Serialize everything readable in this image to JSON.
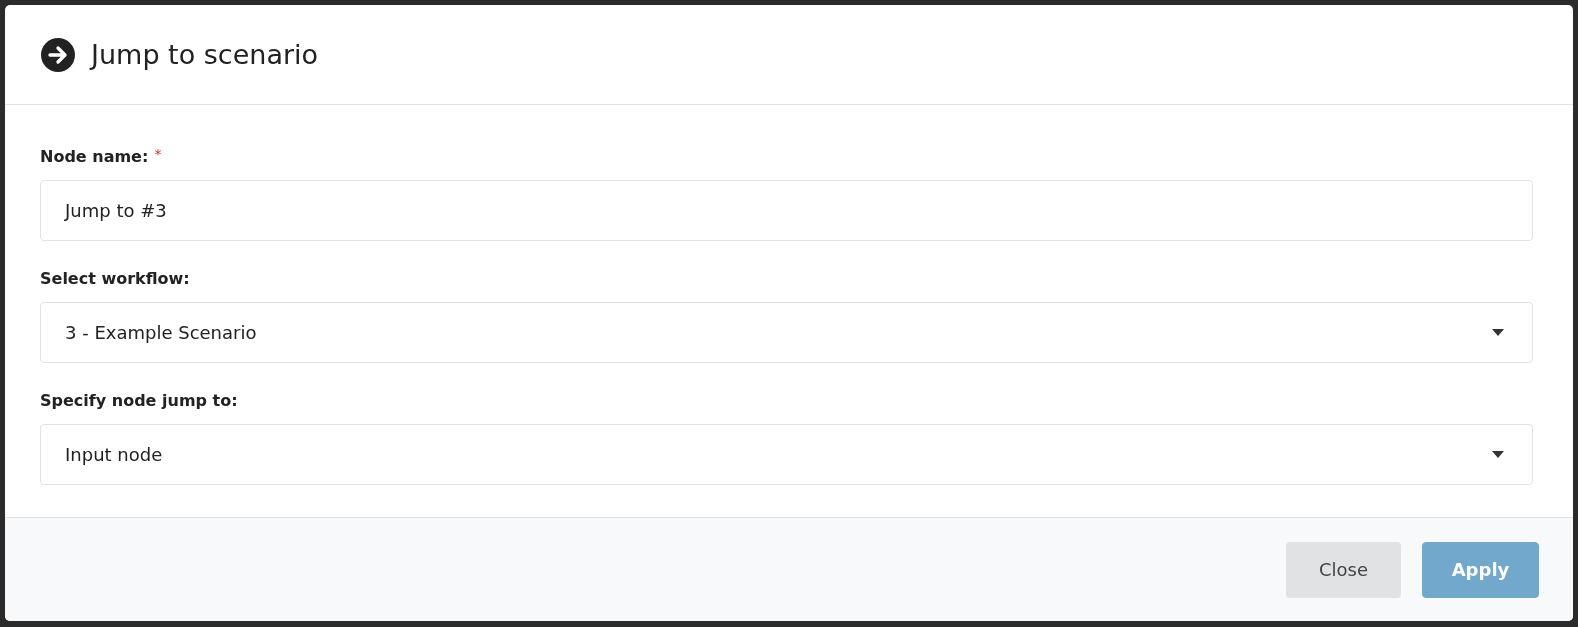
{
  "dialog": {
    "title": "Jump to scenario",
    "fields": [
      {
        "kind": "text",
        "label": "Node name:",
        "required_mark": "*",
        "value": "Jump to #3"
      },
      {
        "kind": "select",
        "label": "Select workflow:",
        "value": "3 - Example Scenario"
      },
      {
        "kind": "select",
        "label": "Specify node jump to:",
        "value": "Input node"
      }
    ],
    "buttons": [
      {
        "label": "Close",
        "kind": "secondary",
        "disabled": false
      },
      {
        "label": "Apply",
        "kind": "primary",
        "disabled": true
      }
    ]
  }
}
